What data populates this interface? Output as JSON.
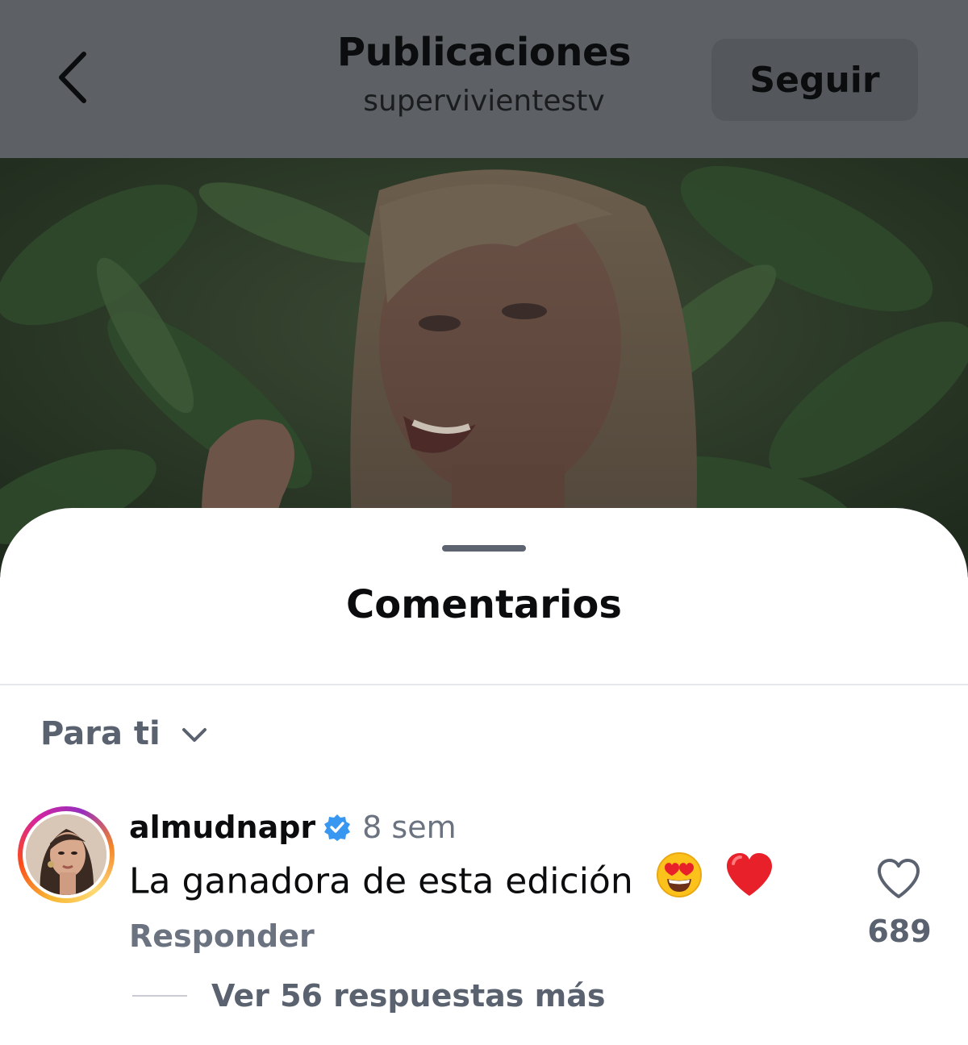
{
  "header": {
    "title": "Publicaciones",
    "account": "supervivientestv",
    "follow_label": "Seguir"
  },
  "icons": {
    "back": "chevron-left-icon",
    "sort": "chevron-down-icon",
    "verified": "verified-badge-icon",
    "like": "heart-outline-icon"
  },
  "comments_sheet": {
    "title": "Comentarios",
    "sort_label": "Para ti",
    "comments": [
      {
        "username": "almudnapr",
        "verified": true,
        "time": "8 sem",
        "text": "La ganadora de esta edición",
        "emojis": [
          "heart-eyes-emoji",
          "red-heart-emoji"
        ],
        "reply_label": "Responder",
        "likes": "689",
        "view_replies": "Ver 56 respuestas más"
      }
    ]
  },
  "colors": {
    "overlay": "#5d6165",
    "verified_blue": "#3897f0",
    "muted_text": "#6b7280"
  }
}
